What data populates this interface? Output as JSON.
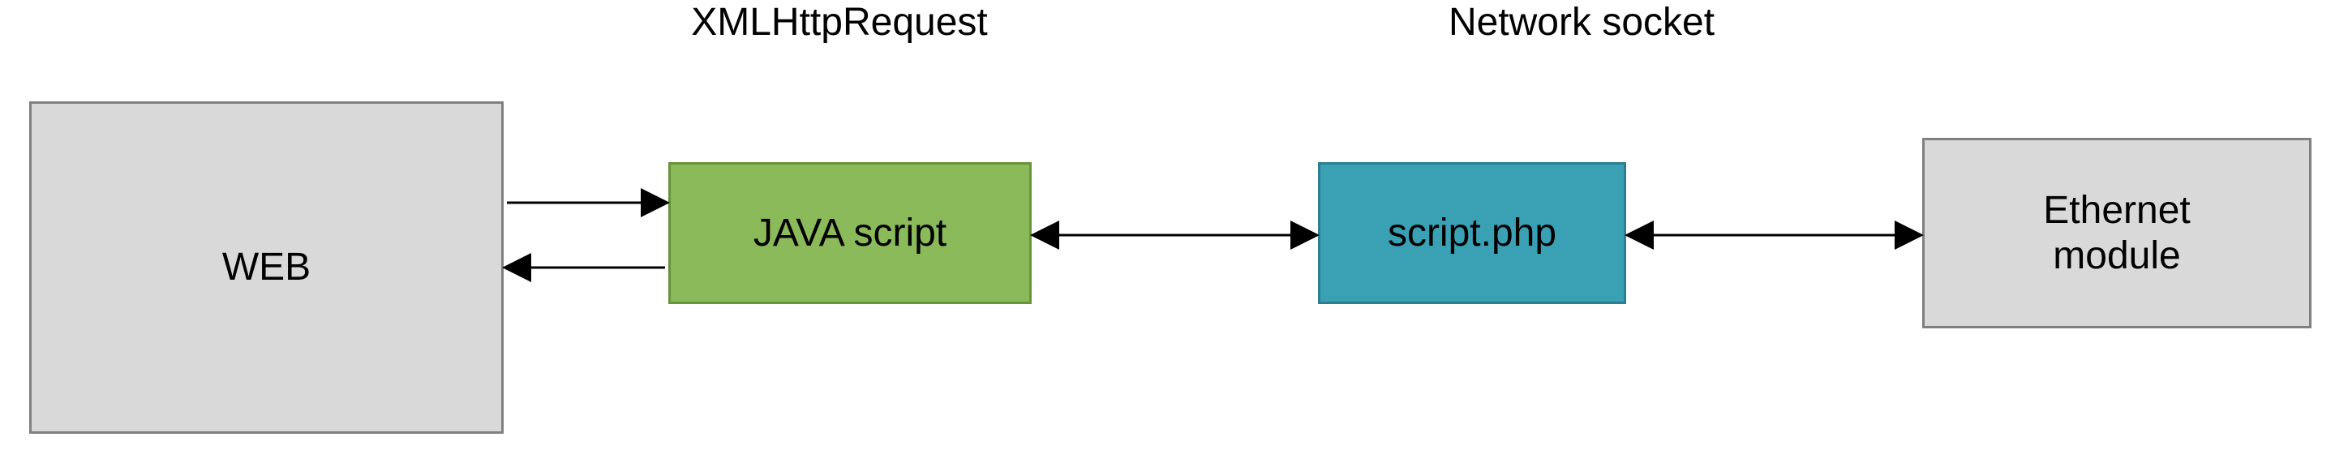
{
  "nodes": {
    "web": "WEB",
    "javascript": "JAVA script",
    "scriptphp": "script.php",
    "ethernet": "Ethernet\nmodule"
  },
  "labels": {
    "xhr": "XMLHttpRequest",
    "socket": "Network socket"
  }
}
